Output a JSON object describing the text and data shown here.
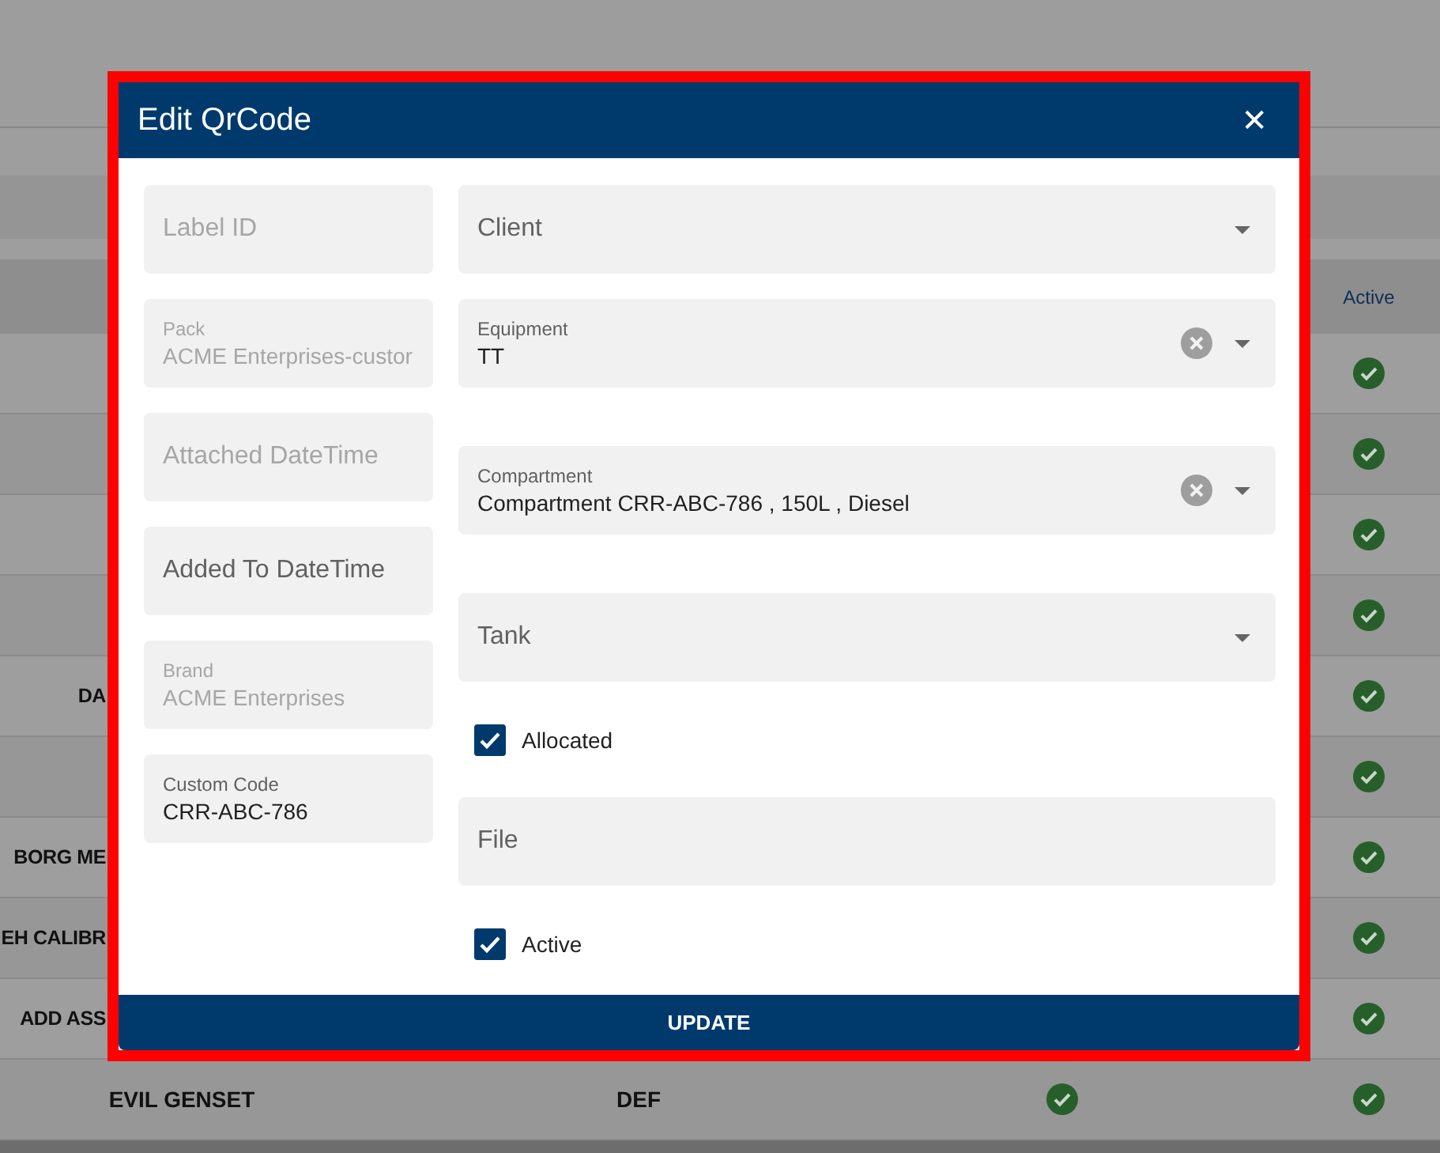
{
  "table": {
    "columns": [
      {
        "label": "Active"
      }
    ],
    "rows": [
      {
        "active": true
      },
      {
        "active": true
      },
      {
        "active": true
      },
      {
        "active": true
      },
      {
        "name": "DA",
        "active": true
      },
      {
        "active": true
      },
      {
        "name": "BORG ME",
        "active": true
      },
      {
        "name": "EH CALIBR",
        "active": true
      },
      {
        "name": "ADD ASS",
        "active": true
      },
      {
        "name": "EVIL GENSET",
        "code": "DEF",
        "column_4": true,
        "active": true
      }
    ]
  },
  "dialog": {
    "title": "Edit QrCode",
    "close": "✕",
    "button": "UPDATE",
    "left_fields": [
      {
        "label": "Label ID",
        "disabled": true
      },
      {
        "label": "Pack",
        "value": "ACME Enterprises-custor",
        "disabled": true
      },
      {
        "label": "Attached DateTime",
        "disabled": true
      },
      {
        "label": "Added To DateTime",
        "disabled": false
      },
      {
        "label": "Brand",
        "value": "ACME Enterprises",
        "disabled": true
      },
      {
        "label": "Custom Code",
        "value": "CRR-ABC-786",
        "disabled": false
      }
    ],
    "right_fields": [
      {
        "kind": "select",
        "label": "Client",
        "clearable": false
      },
      {
        "kind": "select",
        "label": "Equipment",
        "value": "TT",
        "clearable": true
      },
      {
        "kind": "select",
        "label": "Compartment",
        "value": "Compartment CRR-ABC-786 , 150L , Diesel",
        "clearable": true
      },
      {
        "kind": "select",
        "label": "Tank",
        "clearable": false
      },
      {
        "kind": "checkbox",
        "label": "Allocated",
        "checked": true
      },
      {
        "kind": "text",
        "label": "File"
      },
      {
        "kind": "checkbox",
        "label": "Active",
        "checked": true
      }
    ]
  }
}
